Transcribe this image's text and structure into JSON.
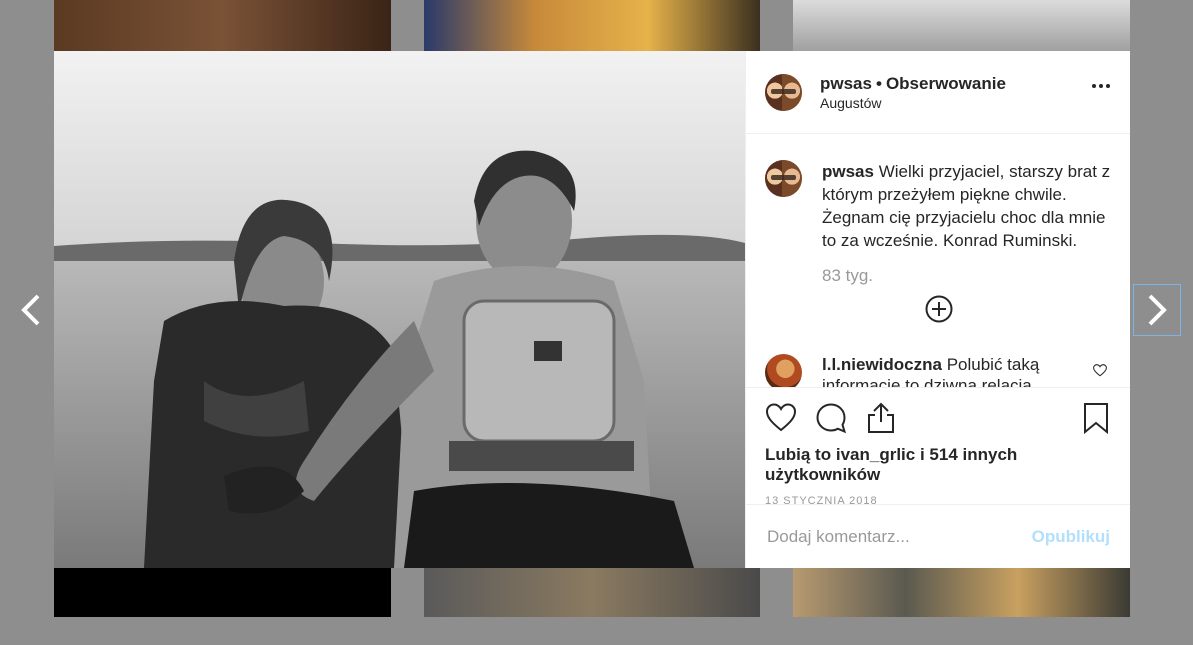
{
  "post": {
    "username": "pwsas",
    "separator": "•",
    "follow_status": "Obserwowanie",
    "location": "Augustów"
  },
  "caption": {
    "username": "pwsas",
    "text": "Wielki przyjaciel, starszy brat z którym przeżyłem piękne chwile. Żegnam cię przyjacielu choc dla mnie to za wcześnie. Konrad Ruminski.",
    "time": "83 tyg."
  },
  "reply": {
    "username": "l.l.niewidoczna",
    "text": "Polubić taką informacje to dziwna relacja..."
  },
  "likes": {
    "prefix": "Lubią to",
    "user": "ivan_grlic",
    "conjunction": "i",
    "others": "514 innych użytkowników"
  },
  "date": "13 stycznia 2018",
  "comment_input": {
    "placeholder": "Dodaj komentarz..."
  },
  "post_button": "Opublikuj",
  "colors": {
    "text": "#262626",
    "muted": "#999999",
    "post_disabled": "#b2dffc",
    "border": "#efefef"
  }
}
